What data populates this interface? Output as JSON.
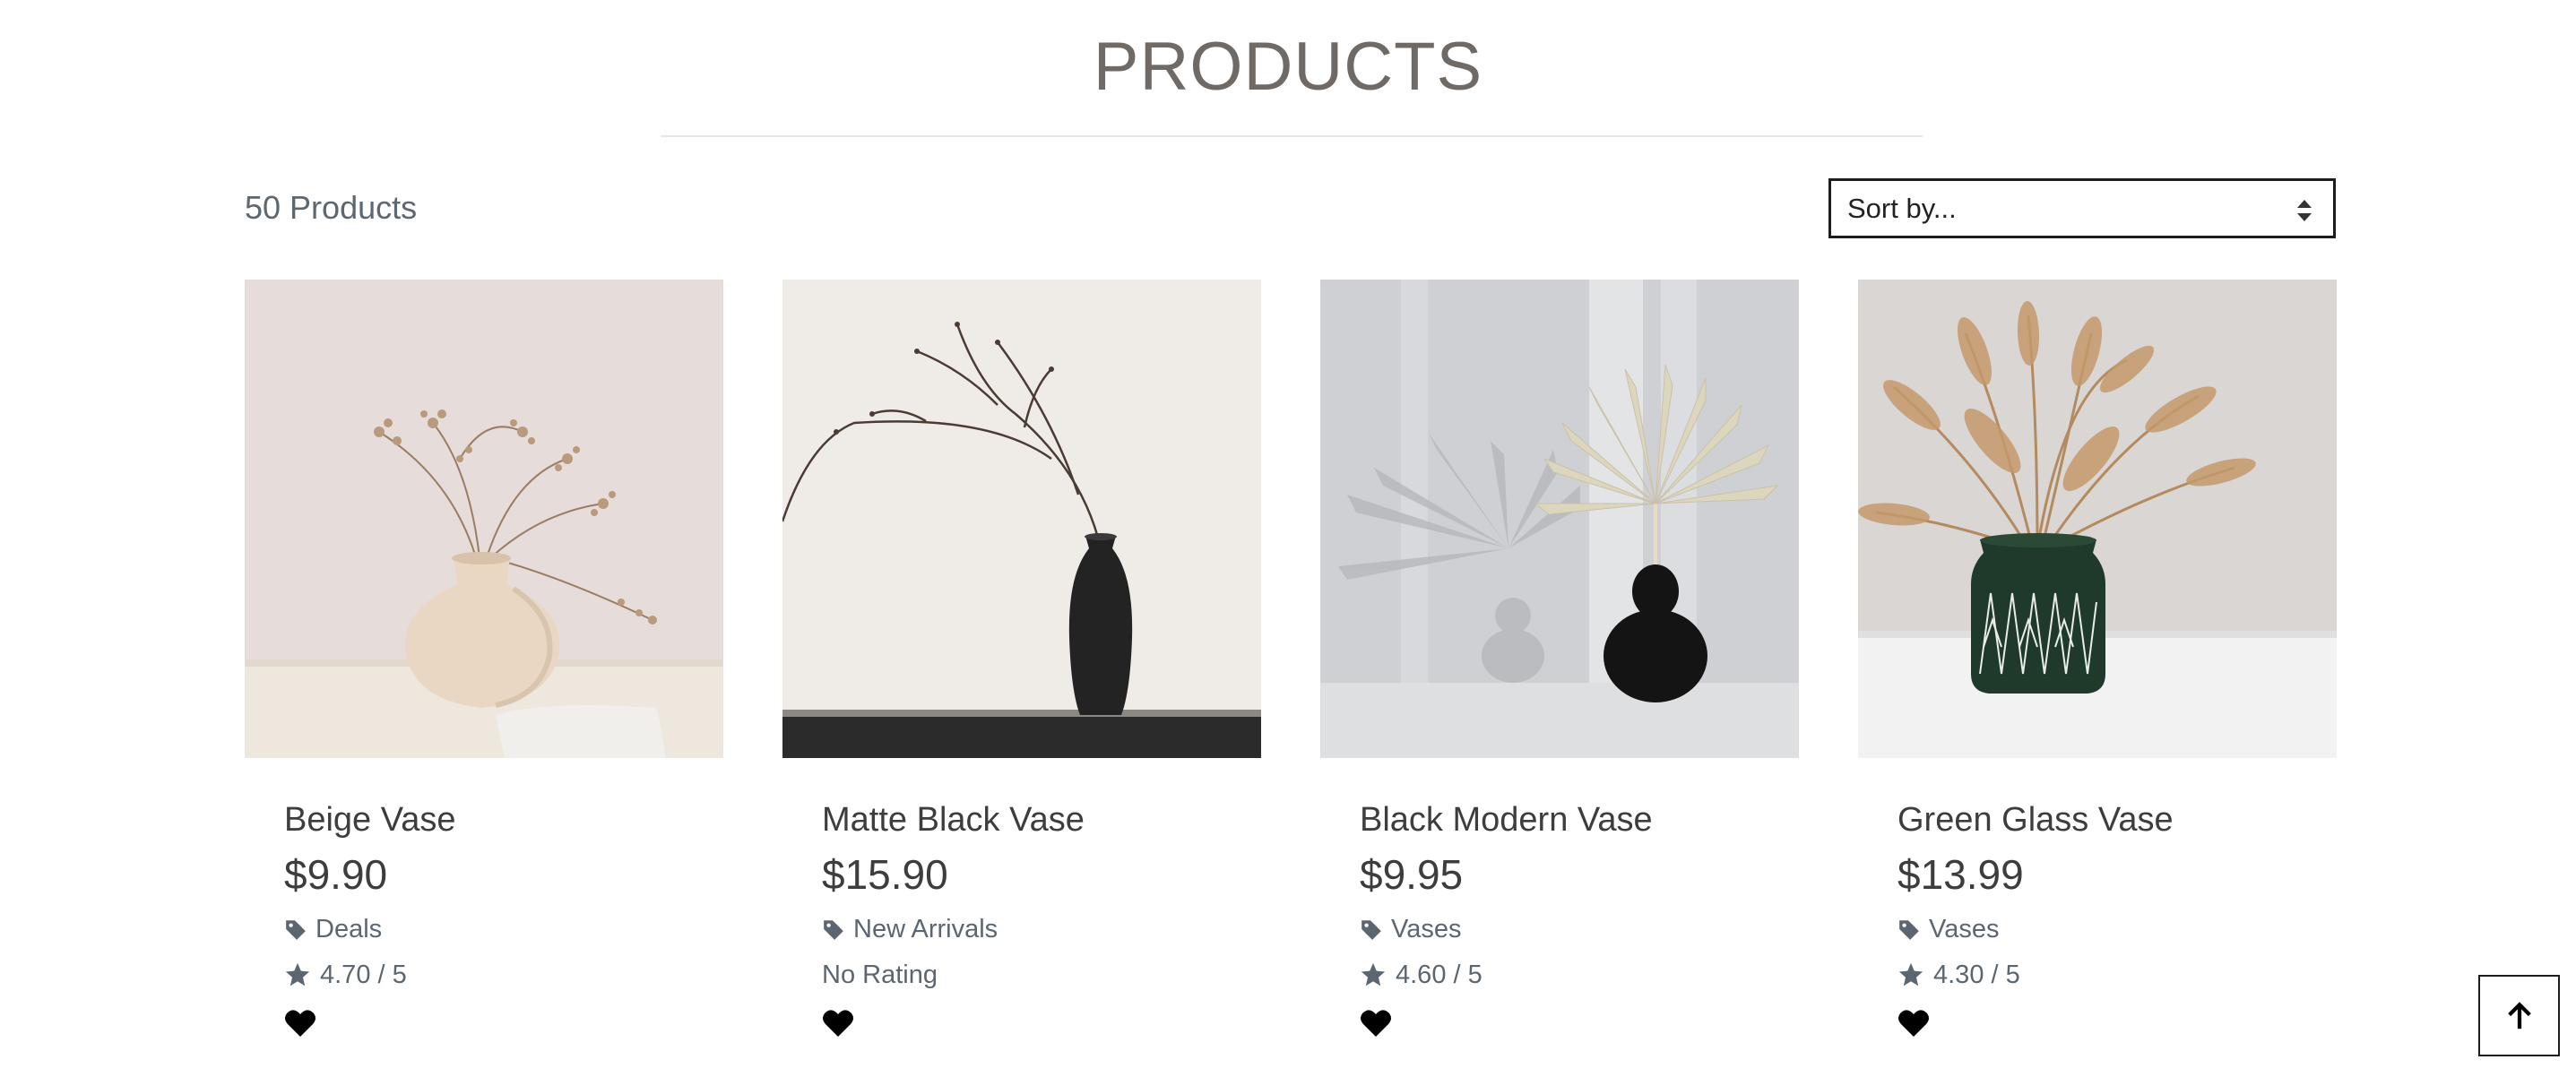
{
  "page": {
    "title": "PRODUCTS",
    "product_count": "50 Products",
    "sort": {
      "selected": "Sort by..."
    }
  },
  "products": [
    {
      "name": "Beige Vase",
      "price": "$9.90",
      "category": "Deals",
      "rating": "4.70 / 5",
      "image": "beige-vase-photo"
    },
    {
      "name": "Matte Black Vase",
      "price": "$15.90",
      "category": "New Arrivals",
      "rating": "No Rating",
      "image": "black-vase-photo"
    },
    {
      "name": "Black Modern Vase",
      "price": "$9.95",
      "category": "Vases",
      "rating": "4.60 / 5",
      "image": "black-modern-vase-photo"
    },
    {
      "name": "Green Glass Vase",
      "price": "$13.99",
      "category": "Vases",
      "rating": "4.30 / 5",
      "image": "green-glass-vase-photo"
    }
  ],
  "icons": {
    "category": "tag-icon",
    "rating": "star-icon",
    "favorite": "heart-icon",
    "sort": "sort-arrows-icon",
    "back_to_top": "arrow-up-icon"
  },
  "colors": {
    "title": "#6f6a65",
    "text": "#3d3d3d",
    "muted": "#5b6670",
    "border": "#1d1d1d"
  }
}
